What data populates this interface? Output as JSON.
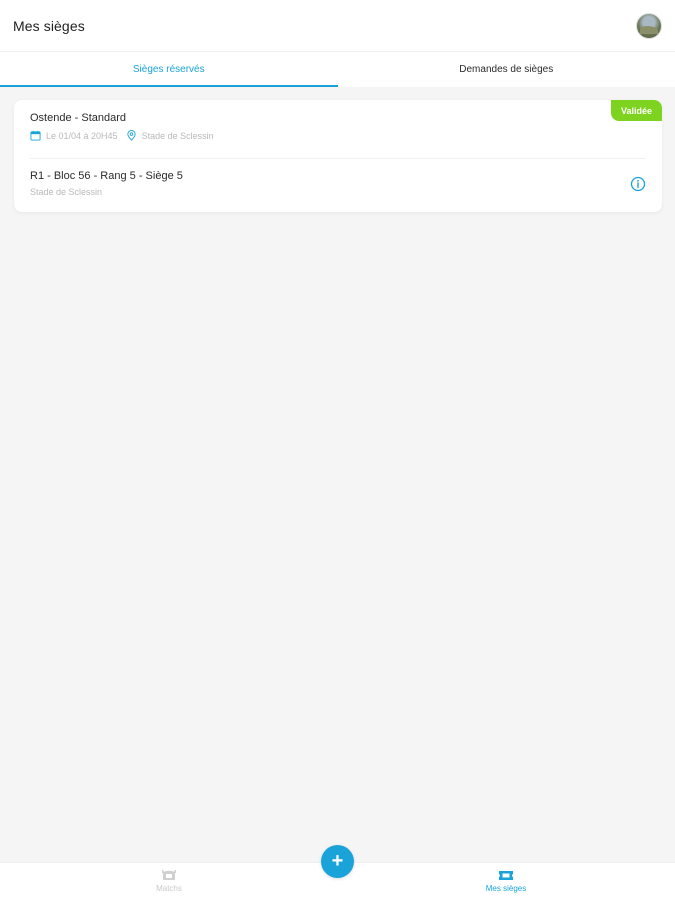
{
  "header": {
    "title": "Mes sièges",
    "avatar_icon": "user-avatar"
  },
  "tabs": [
    {
      "label": "Sièges réservés",
      "active": true
    },
    {
      "label": "Demandes de sièges",
      "active": false
    }
  ],
  "reservation": {
    "title": "Ostende - Standard",
    "status": "Validée",
    "date": "Le 01/04 à 20H45",
    "venue": "Stade de Sclessin",
    "seat": "R1 - Bloc 56 - Rang 5 - Siège 5",
    "seat_venue": "Stade de Sclessin"
  },
  "bottom_nav": {
    "items": [
      {
        "label": "Matchs",
        "icon": "stadium-icon",
        "active": false
      },
      {
        "label": "Mes sièges",
        "icon": "ticket-icon",
        "active": true
      }
    ],
    "fab_label": "+"
  },
  "colors": {
    "accent": "#1aa3d9",
    "status_valid": "#7ed321",
    "muted_text": "#b9b9b9",
    "background": "#f5f5f5"
  }
}
